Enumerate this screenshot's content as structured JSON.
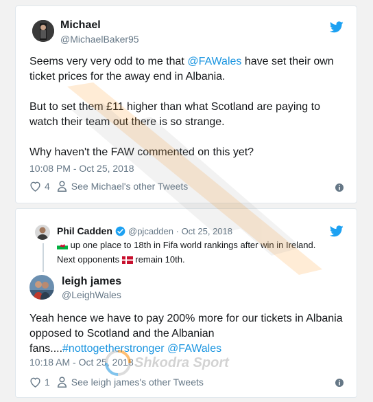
{
  "tweet1": {
    "author_name": "Michael",
    "author_handle": "@MichaelBaker95",
    "text_line1_pre": "Seems very very odd to me that ",
    "text_line1_mention": "@FAWales",
    "text_line1_post": " have set their own",
    "text_line2": "ticket prices for the away end in Albania.",
    "text_line3": "But to set them £11 higher than what Scotland are paying to",
    "text_line4": "watch their team out there is so strange.",
    "text_line5": "Why haven't the FAW commented on this yet?",
    "timestamp": "10:08 PM - Oct 25, 2018",
    "like_count": "4",
    "see_other": "See Michael's other Tweets"
  },
  "tweet2": {
    "quoted": {
      "author_name": "Phil Cadden",
      "author_handle": "@pjcadden",
      "separator": "·",
      "date": "Oct 25, 2018",
      "line1": " up one place to 18th in Fifa world rankings after win in Ireland.",
      "line2_pre": "Next opponents ",
      "line2_post": " remain 10th."
    },
    "author_name": "leigh james",
    "author_handle": "@LeighWales",
    "text_line1": "Yeah hence we have to pay 200% more for our tickets in Albania",
    "text_line2": "opposed to Scotland and the Albanian",
    "text_line3_pre": "fans....",
    "text_line3_hashtag": "#nottogetherstronger",
    "text_line3_mid": " ",
    "text_line3_mention": "@FAWales",
    "timestamp": "10:18 AM - Oct 25, 2018",
    "like_count": "1",
    "see_other": "See leigh james's other Tweets"
  },
  "watermark": {
    "brand": "Shkodra Sport"
  },
  "colors": {
    "link": "#1b95e0",
    "twitter_blue": "#1da1f2",
    "muted": "#657786",
    "verified": "#1da1f2"
  }
}
